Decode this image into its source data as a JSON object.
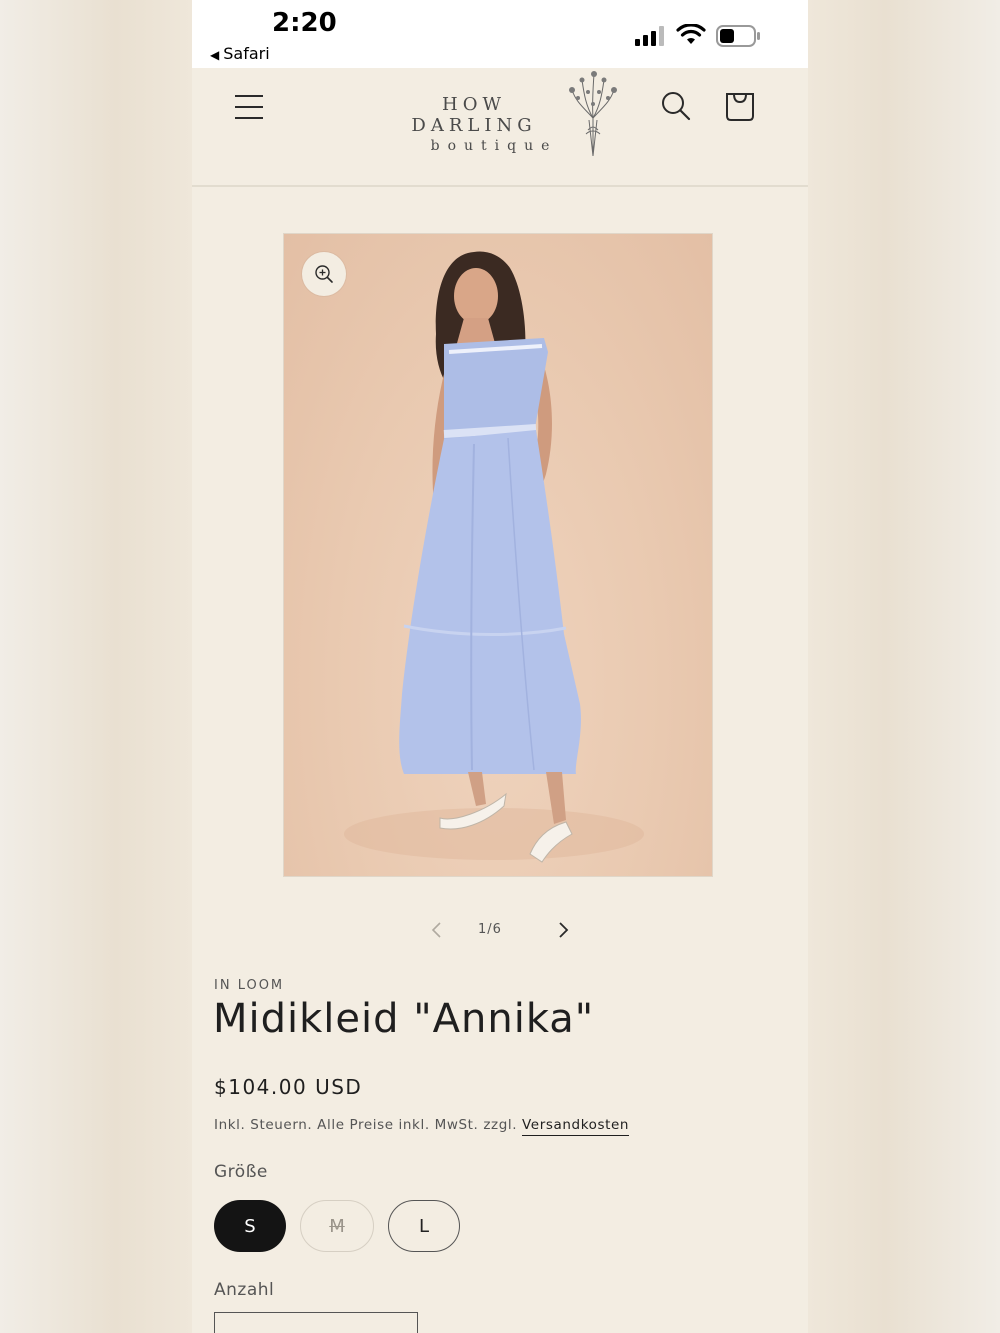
{
  "status_bar": {
    "time": "2:20",
    "back_app": "Safari"
  },
  "header": {
    "logo_main": "HOW DARLING",
    "logo_sub": "boutique",
    "icons": [
      "menu-icon",
      "search-icon",
      "cart-icon"
    ]
  },
  "gallery": {
    "counter": "1/6",
    "current": 1,
    "total": 6
  },
  "product": {
    "vendor": "IN LOOM",
    "title": "Midikleid \"Annika\"",
    "price": "$104.00 USD",
    "tax_note": "Inkl. Steuern. Alle Preise inkl. MwSt. zzgl. ",
    "shipping_link": "Versandkosten",
    "size_label": "Größe",
    "sizes": [
      {
        "label": "S",
        "selected": true,
        "available": true
      },
      {
        "label": "M",
        "selected": false,
        "available": false
      },
      {
        "label": "L",
        "selected": false,
        "available": true
      }
    ],
    "quantity_label": "Anzahl"
  },
  "colors": {
    "background": "#f3ede2",
    "selected_pill": "#141414",
    "text": "#1f1f1f"
  }
}
